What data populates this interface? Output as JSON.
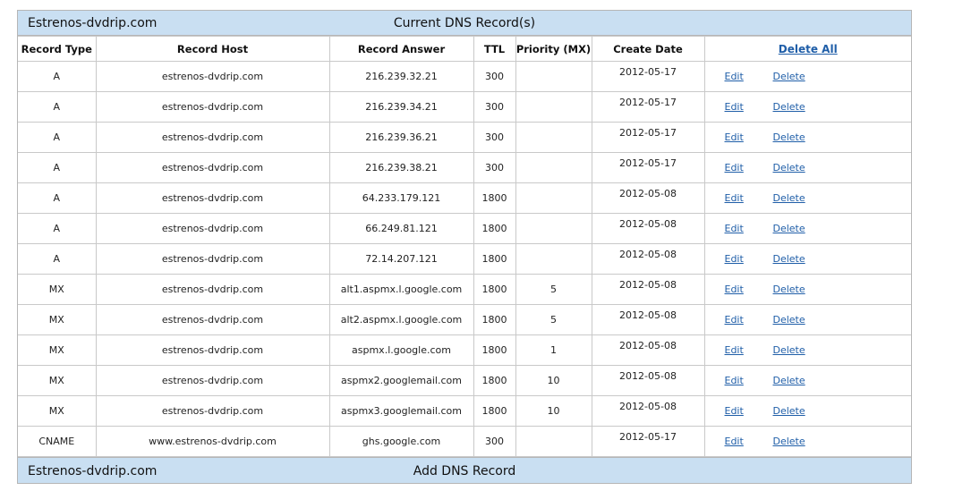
{
  "header": {
    "domain": "Estrenos-dvdrip.com",
    "title": "Current DNS Record(s)"
  },
  "columns": {
    "type": "Record Type",
    "host": "Record Host",
    "answer": "Record Answer",
    "ttl": "TTL",
    "priority": "Priority (MX)",
    "date": "Create Date",
    "delete_all": "Delete All"
  },
  "actions": {
    "edit": "Edit",
    "delete": "Delete"
  },
  "records": [
    {
      "type": "A",
      "host": "estrenos-dvdrip.com",
      "answer": "216.239.32.21",
      "ttl": "300",
      "priority": "",
      "date": "2012-05-17"
    },
    {
      "type": "A",
      "host": "estrenos-dvdrip.com",
      "answer": "216.239.34.21",
      "ttl": "300",
      "priority": "",
      "date": "2012-05-17"
    },
    {
      "type": "A",
      "host": "estrenos-dvdrip.com",
      "answer": "216.239.36.21",
      "ttl": "300",
      "priority": "",
      "date": "2012-05-17"
    },
    {
      "type": "A",
      "host": "estrenos-dvdrip.com",
      "answer": "216.239.38.21",
      "ttl": "300",
      "priority": "",
      "date": "2012-05-17"
    },
    {
      "type": "A",
      "host": "estrenos-dvdrip.com",
      "answer": "64.233.179.121",
      "ttl": "1800",
      "priority": "",
      "date": "2012-05-08"
    },
    {
      "type": "A",
      "host": "estrenos-dvdrip.com",
      "answer": "66.249.81.121",
      "ttl": "1800",
      "priority": "",
      "date": "2012-05-08"
    },
    {
      "type": "A",
      "host": "estrenos-dvdrip.com",
      "answer": "72.14.207.121",
      "ttl": "1800",
      "priority": "",
      "date": "2012-05-08"
    },
    {
      "type": "MX",
      "host": "estrenos-dvdrip.com",
      "answer": "alt1.aspmx.l.google.com",
      "ttl": "1800",
      "priority": "5",
      "date": "2012-05-08"
    },
    {
      "type": "MX",
      "host": "estrenos-dvdrip.com",
      "answer": "alt2.aspmx.l.google.com",
      "ttl": "1800",
      "priority": "5",
      "date": "2012-05-08"
    },
    {
      "type": "MX",
      "host": "estrenos-dvdrip.com",
      "answer": "aspmx.l.google.com",
      "ttl": "1800",
      "priority": "1",
      "date": "2012-05-08"
    },
    {
      "type": "MX",
      "host": "estrenos-dvdrip.com",
      "answer": "aspmx2.googlemail.com",
      "ttl": "1800",
      "priority": "10",
      "date": "2012-05-08"
    },
    {
      "type": "MX",
      "host": "estrenos-dvdrip.com",
      "answer": "aspmx3.googlemail.com",
      "ttl": "1800",
      "priority": "10",
      "date": "2012-05-08"
    },
    {
      "type": "CNAME",
      "host": "www.estrenos-dvdrip.com",
      "answer": "ghs.google.com",
      "ttl": "300",
      "priority": "",
      "date": "2012-05-17"
    }
  ],
  "footer": {
    "domain": "Estrenos-dvdrip.com",
    "title": "Add DNS Record"
  },
  "colors": {
    "header_bg": "#c9dff2",
    "link": "#1f5ea8",
    "border": "#c9c9c9"
  }
}
